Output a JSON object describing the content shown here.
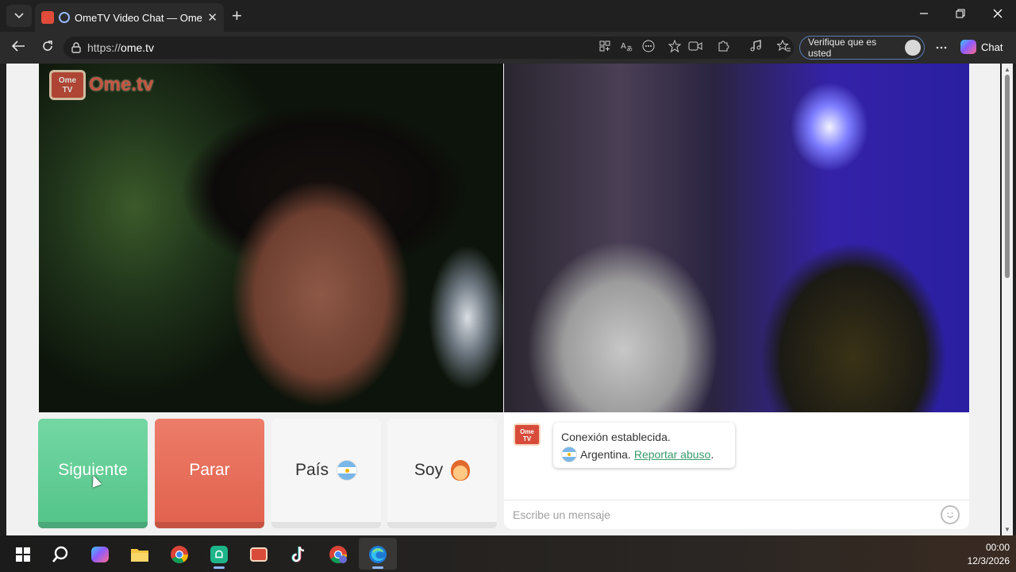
{
  "browser": {
    "tab_title": "OmeTV Video Chat — Omegle",
    "tab_close": "✕",
    "new_tab": "+",
    "url_scheme": "https://",
    "url_host": "ome.tv",
    "profile_label": "Verifique que es usted",
    "chat_label": "Chat"
  },
  "page": {
    "logo_text": "Ome.tv",
    "logo_badge_top": "Ome",
    "logo_badge_bottom": "TV"
  },
  "controls": {
    "next_label": "Siguiente",
    "stop_label": "Parar",
    "country_label": "País",
    "soy_label": "Soy"
  },
  "chat": {
    "message_line1": "Conexión establecida.",
    "country": "Argentina.",
    "report_link": "Reportar abuso",
    "report_period": ".",
    "input_placeholder": "Escribe un mensaje",
    "badge_top": "Ome",
    "badge_bottom": "TV"
  },
  "taskbar": {
    "time": "00:00",
    "date": "12/3/2026"
  },
  "colors": {
    "next_green": "#5ccb92",
    "stop_red": "#e56a55",
    "link_green": "#3a9a6a"
  }
}
